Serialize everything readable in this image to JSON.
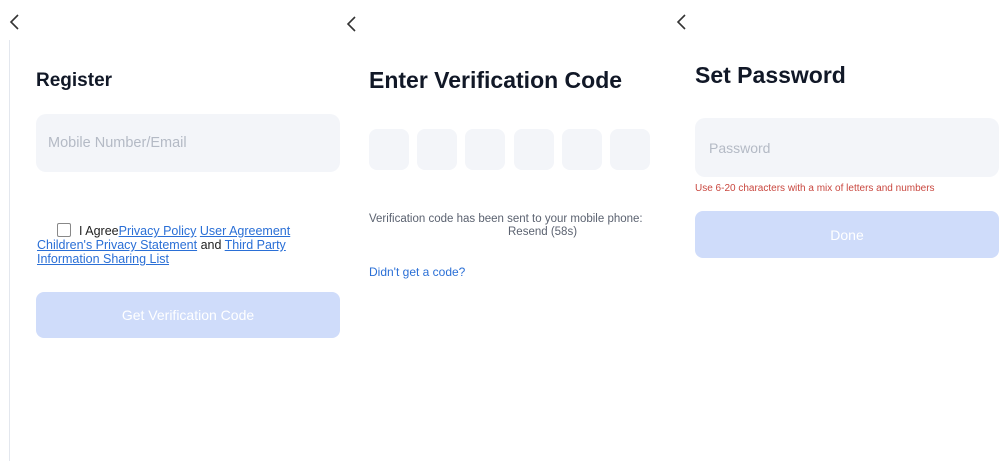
{
  "register": {
    "title": "Register",
    "input_placeholder": "Mobile Number/Email",
    "agree_prefix": "I Agree",
    "privacy_policy": "Privacy Policy",
    "user_agreement": "User Agreement",
    "childrens_privacy": "Children's Privacy Statement",
    "and": " and ",
    "third_party": "Third Party Information Sharing List",
    "button": "Get Verification Code"
  },
  "verify": {
    "title": "Enter Verification Code",
    "sent_text": "Verification code has been sent to your mobile phone:",
    "resend": "Resend (58s)",
    "didnt_get": "Didn't get a code?"
  },
  "password": {
    "title": "Set Password",
    "input_placeholder": "Password",
    "hint": "Use 6-20 characters with a mix of letters and numbers",
    "button": "Done"
  }
}
